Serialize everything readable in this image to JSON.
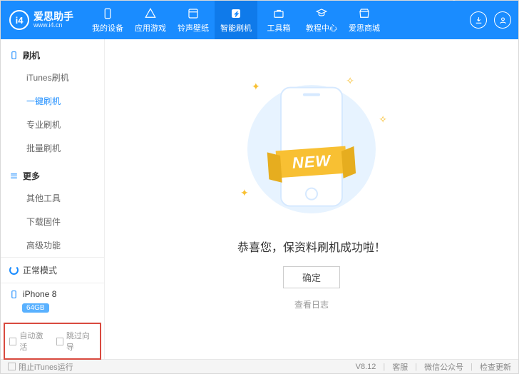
{
  "brand": {
    "badge": "i4",
    "name_zh": "爱思助手",
    "name_en": "www.i4.cn"
  },
  "nav": {
    "items": [
      {
        "label": "我的设备"
      },
      {
        "label": "应用游戏"
      },
      {
        "label": "铃声壁纸"
      },
      {
        "label": "智能刷机"
      },
      {
        "label": "工具箱"
      },
      {
        "label": "教程中心"
      },
      {
        "label": "爱思商城"
      }
    ],
    "active_index": 3
  },
  "sidebar": {
    "sections": [
      {
        "title": "刷机",
        "items": [
          "iTunes刷机",
          "一键刷机",
          "专业刷机",
          "批量刷机"
        ],
        "active_index": 1
      },
      {
        "title": "更多",
        "items": [
          "其他工具",
          "下载固件",
          "高级功能"
        ],
        "active_index": -1
      }
    ],
    "mode_label": "正常模式",
    "device_name": "iPhone 8",
    "device_capacity": "64GB",
    "check_auto_activate": "自动激活",
    "check_skip_guide": "跳过向导"
  },
  "main": {
    "ribbon": "NEW",
    "success_text": "恭喜您，保资料刷机成功啦！",
    "ok_button": "确定",
    "view_log": "查看日志"
  },
  "footer": {
    "block_itunes": "阻止iTunes运行",
    "version": "V8.12",
    "support": "客服",
    "wechat": "微信公众号",
    "check_update": "检查更新"
  }
}
